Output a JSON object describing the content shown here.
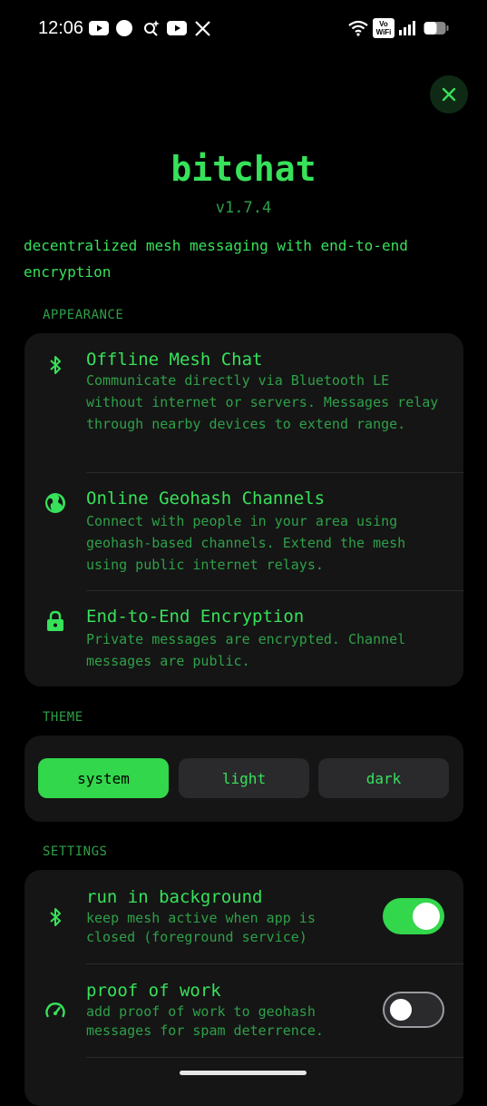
{
  "status_bar": {
    "time": "12:06",
    "vowifi": "Vo WiFi"
  },
  "header": {
    "title": "bitchat",
    "version": "v1.7.4",
    "tagline": "decentralized mesh messaging with end-to-end encryption"
  },
  "appearance": {
    "label": "APPEARANCE",
    "features": [
      {
        "icon": "bluetooth-icon",
        "name": "Offline Mesh Chat",
        "desc": "Communicate directly via Bluetooth LE without internet or servers. Messages relay through nearby devices to extend range."
      },
      {
        "icon": "globe-icon",
        "name": "Online Geohash Channels",
        "desc": "Connect with people in your area using geohash-based channels. Extend the mesh using public internet relays."
      },
      {
        "icon": "lock-icon",
        "name": "End-to-End Encryption",
        "desc": "Private messages are encrypted. Channel messages are public."
      }
    ]
  },
  "theme": {
    "label": "THEME",
    "options": [
      "system",
      "light",
      "dark"
    ],
    "selected": "system"
  },
  "settings": {
    "label": "SETTINGS",
    "items": [
      {
        "icon": "bluetooth-icon",
        "name": "run in background",
        "desc": "keep mesh active when app is closed (foreground service)",
        "enabled": true
      },
      {
        "icon": "speedometer-icon",
        "name": "proof of work",
        "desc": "add proof of work to geohash messages for spam deterrence.",
        "enabled": false
      }
    ]
  },
  "colors": {
    "accent": "#32d74b",
    "text": "#37e15a",
    "muted": "#2ea048",
    "card": "#151515",
    "background": "#000000"
  }
}
